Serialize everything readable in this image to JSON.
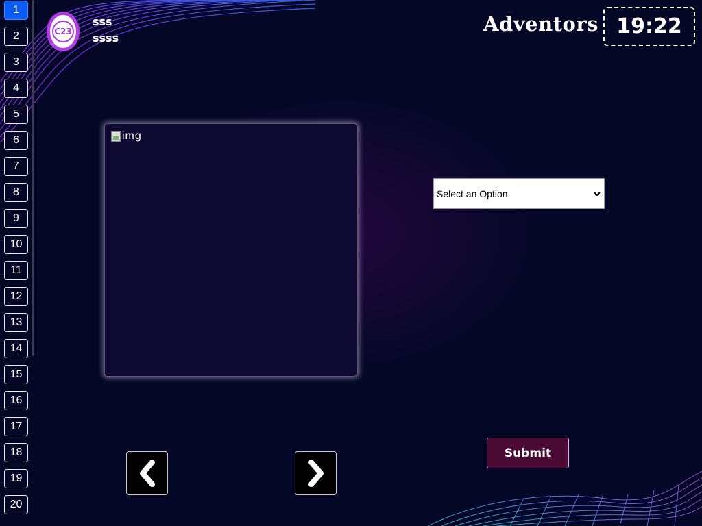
{
  "questions": [
    "1",
    "2",
    "3",
    "4",
    "5",
    "6",
    "7",
    "8",
    "9",
    "10",
    "11",
    "12",
    "13",
    "14",
    "15",
    "16",
    "17",
    "18",
    "19",
    "20"
  ],
  "active_question": "1",
  "header": {
    "avatar_text": "C23",
    "user_name": "sss",
    "user_sub": "ssss",
    "brand": "Adventors",
    "timer": "19:22"
  },
  "question_card": {
    "image_alt": "img"
  },
  "answer_select": {
    "selected": "Select an Option"
  },
  "nav": {
    "prev_icon": "chevron-left-icon",
    "next_icon": "chevron-right-icon"
  },
  "submit_label": "Submit",
  "colors": {
    "background": "#040726",
    "active_question": "#0a5cf5",
    "avatar_ring": "#b23de6",
    "submit_bg": "#4b0a34"
  }
}
